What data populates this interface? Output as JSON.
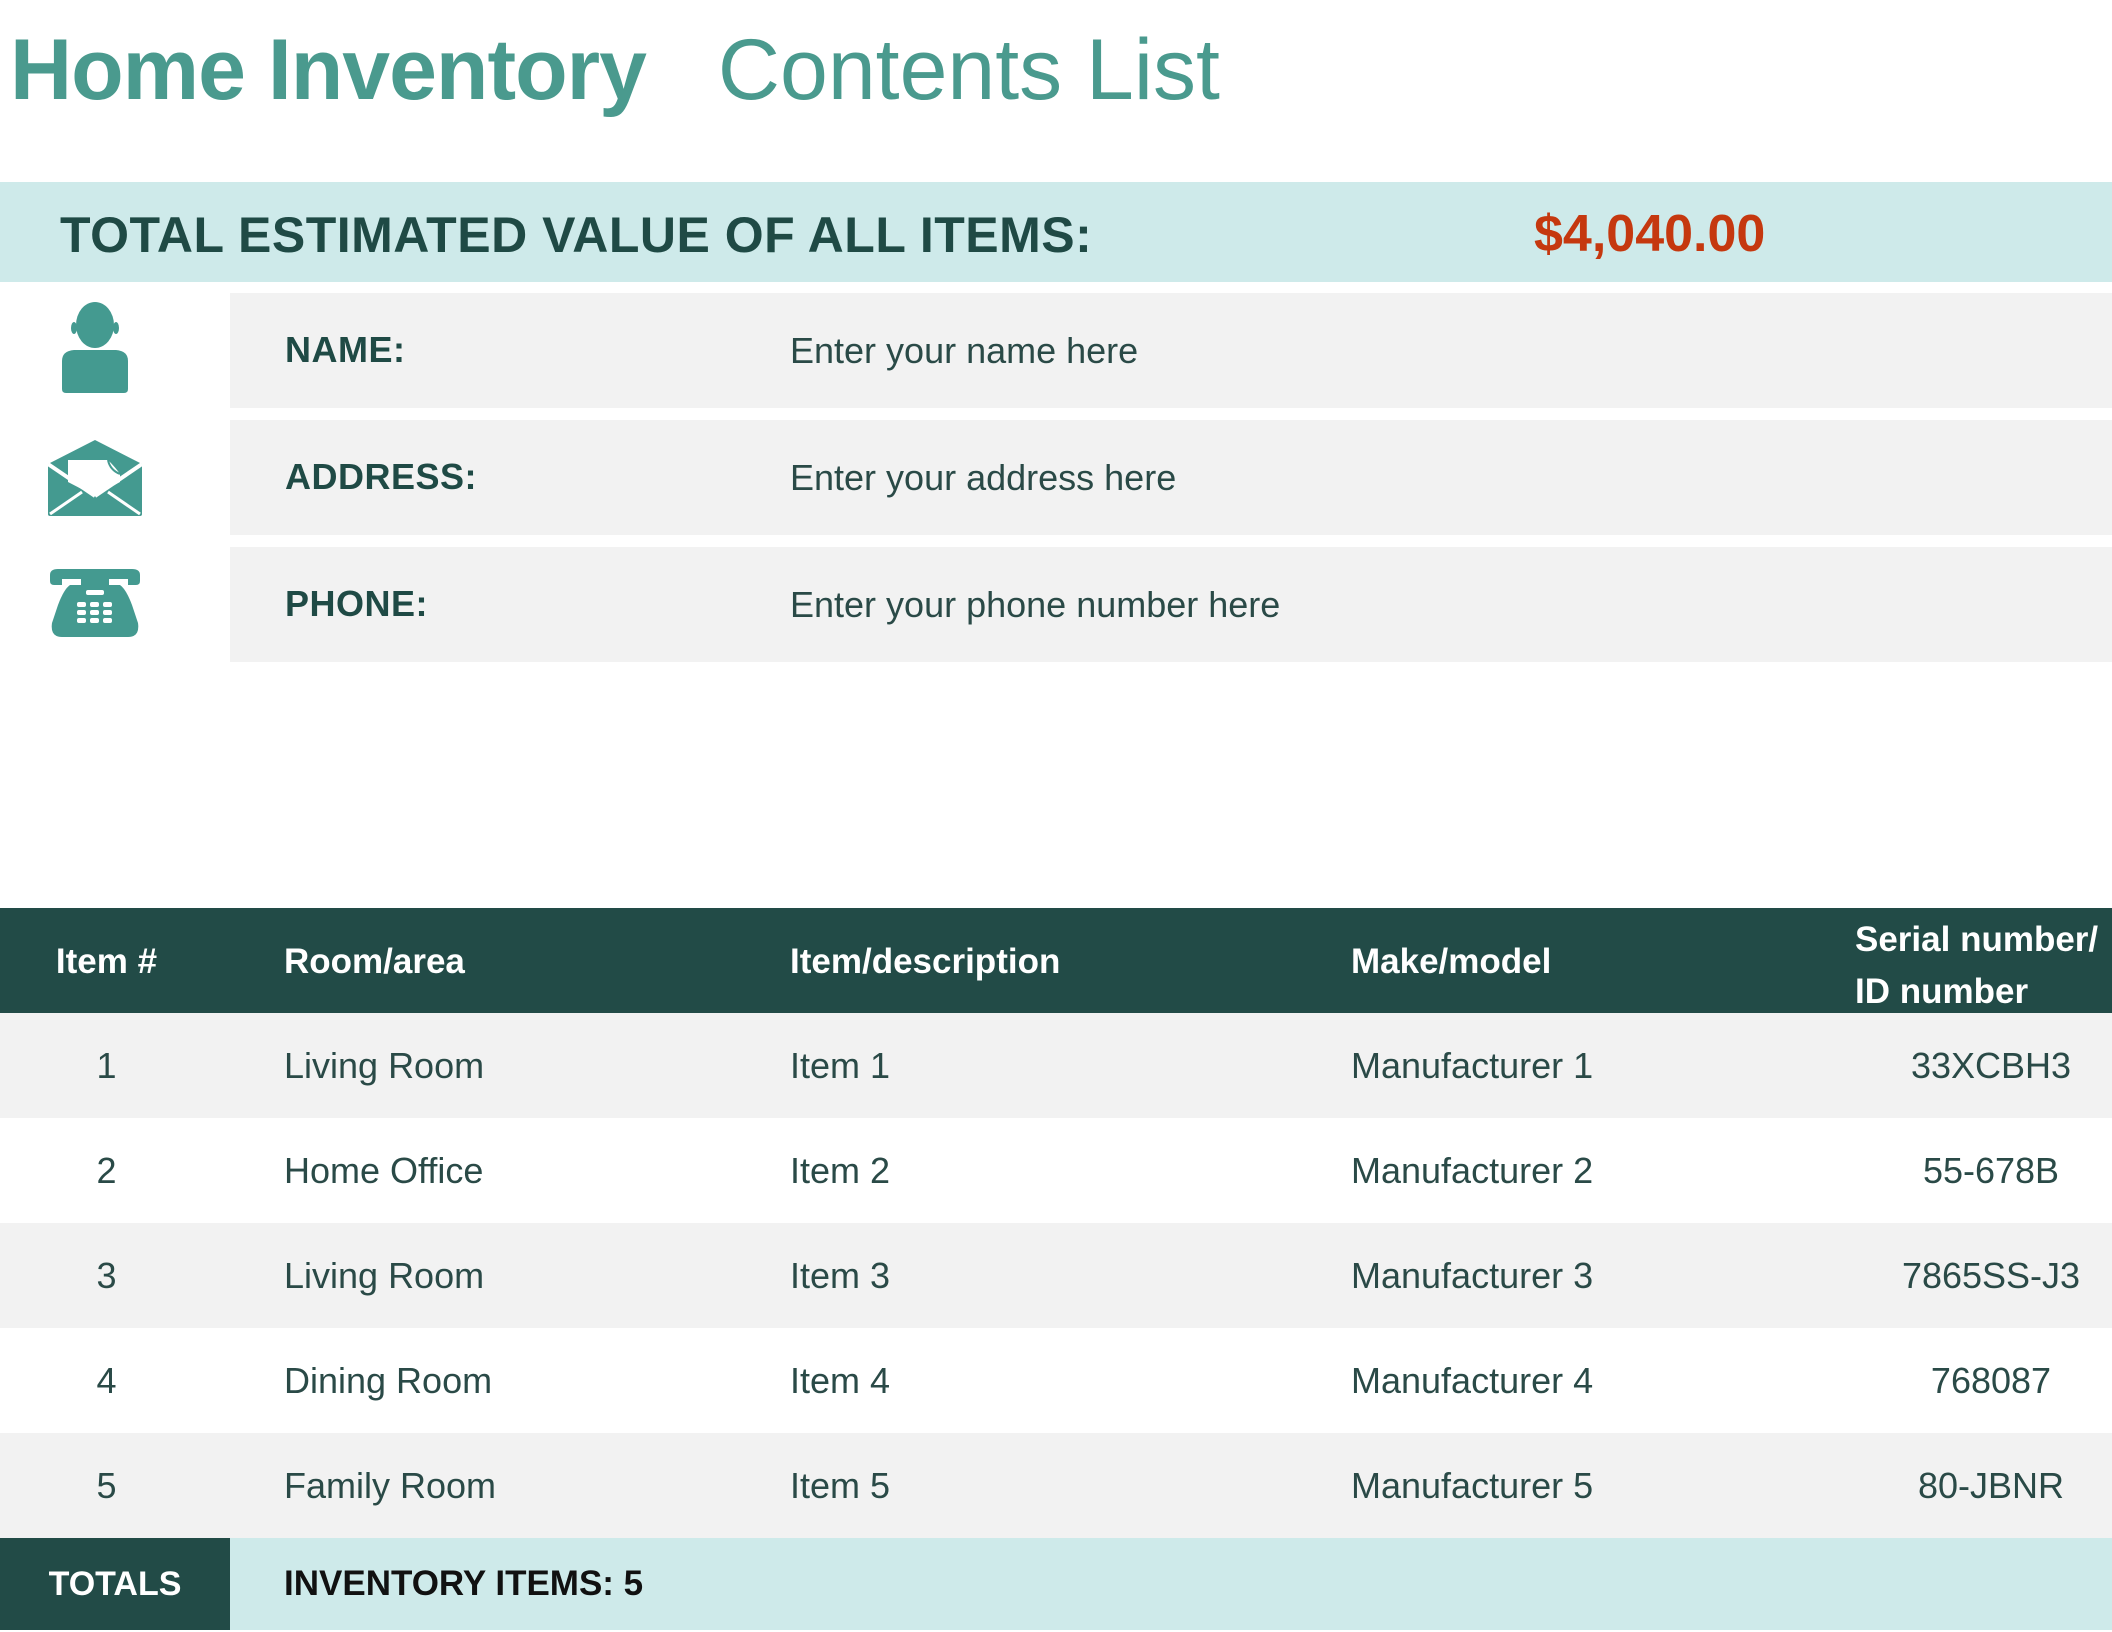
{
  "header": {
    "title_bold": "Home Inventory",
    "title_light": "Contents List"
  },
  "summary": {
    "label": "TOTAL ESTIMATED VALUE OF ALL ITEMS:",
    "value": "$4,040.00"
  },
  "owner_info": {
    "rows": [
      {
        "icon": "person-icon",
        "label": "NAME:",
        "value": "Enter your name here"
      },
      {
        "icon": "envelope-icon",
        "label": "ADDRESS:",
        "value": "Enter your address here"
      },
      {
        "icon": "telephone-icon",
        "label": "PHONE:",
        "value": "Enter your phone number here"
      }
    ]
  },
  "table": {
    "columns": [
      "Item #",
      "Room/area",
      "Item/description",
      "Make/model",
      "Serial number/",
      "ID number"
    ],
    "rows": [
      {
        "num": "1",
        "room": "Living Room",
        "item": "Item 1",
        "make": "Manufacturer 1",
        "serial": "33XCBH3"
      },
      {
        "num": "2",
        "room": "Home Office",
        "item": "Item 2",
        "make": "Manufacturer 2",
        "serial": "55-678B"
      },
      {
        "num": "3",
        "room": "Living Room",
        "item": "Item 3",
        "make": "Manufacturer 3",
        "serial": "7865SS-J3"
      },
      {
        "num": "4",
        "room": "Dining Room",
        "item": "Item 4",
        "make": "Manufacturer 4",
        "serial": "768087"
      },
      {
        "num": "5",
        "room": "Family Room",
        "item": "Item 5",
        "make": "Manufacturer 5",
        "serial": "80-JBNR"
      }
    ],
    "totals": {
      "label": "TOTALS",
      "count_text": "INVENTORY ITEMS: 5"
    }
  },
  "colors": {
    "title": "#4a9a8e",
    "band": "#ceeaea",
    "dark_teal": "#224b47",
    "total_value": "#c5380f",
    "row_alt": "#f2f2f2",
    "icon": "#449a90"
  }
}
